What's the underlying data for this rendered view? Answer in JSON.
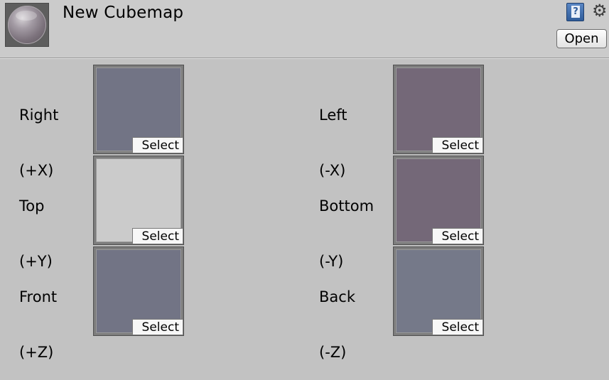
{
  "header": {
    "title": "New Cubemap",
    "open_label": "Open",
    "help_glyph": "?",
    "gear_glyph": "⚙",
    "icons": {
      "asset": "cubemap-asset-icon",
      "help": "help-book-icon",
      "settings": "gear-icon"
    }
  },
  "faces": [
    {
      "name": "Right",
      "axis": "(+X)",
      "color": "#727485",
      "select_label": "Select"
    },
    {
      "name": "Left",
      "axis": "(-X)",
      "color": "#746878",
      "select_label": "Select"
    },
    {
      "name": "Top",
      "axis": "(+Y)",
      "color": "#cbcbcb",
      "select_label": "Select"
    },
    {
      "name": "Bottom",
      "axis": "(-Y)",
      "color": "#746878",
      "select_label": "Select"
    },
    {
      "name": "Front",
      "axis": "(+Z)",
      "color": "#727485",
      "select_label": "Select"
    },
    {
      "name": "Back",
      "axis": "(-Z)",
      "color": "#757989",
      "select_label": "Select"
    }
  ]
}
